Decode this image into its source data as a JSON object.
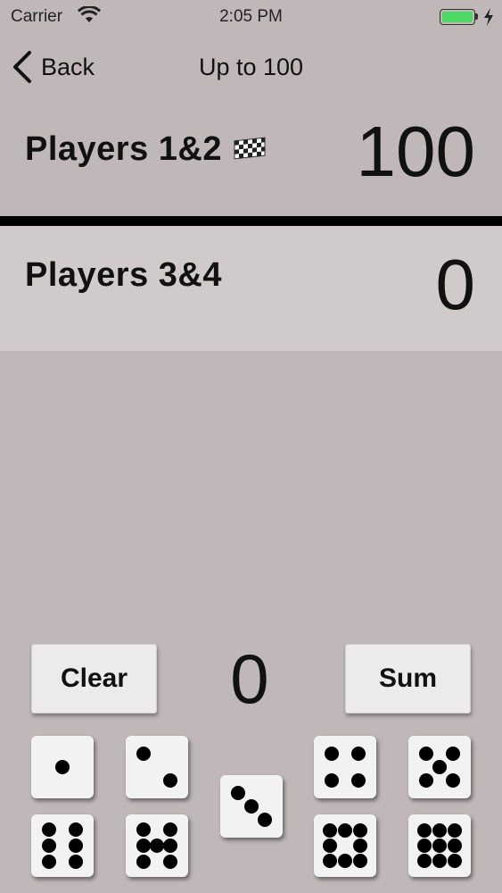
{
  "status": {
    "carrier": "Carrier",
    "time": "2:05 PM",
    "battery_color": "#4cd964"
  },
  "nav": {
    "back_label": "Back",
    "title": "Up to 100"
  },
  "teams": [
    {
      "name": "Players 1&2",
      "score": "100",
      "winner_icon": "checkered-flag"
    },
    {
      "name": "Players 3&4",
      "score": "0"
    }
  ],
  "controls": {
    "clear_label": "Clear",
    "sum_label": "Sum",
    "roll_total": "0"
  },
  "dice": [
    1,
    2,
    3,
    4,
    5,
    6,
    7,
    8,
    9
  ],
  "colors": {
    "background": "#bfb7b8",
    "active_team_bg": "#d1cacb",
    "button_bg": "#ebebeb",
    "die_face": "#f2f2f2"
  }
}
